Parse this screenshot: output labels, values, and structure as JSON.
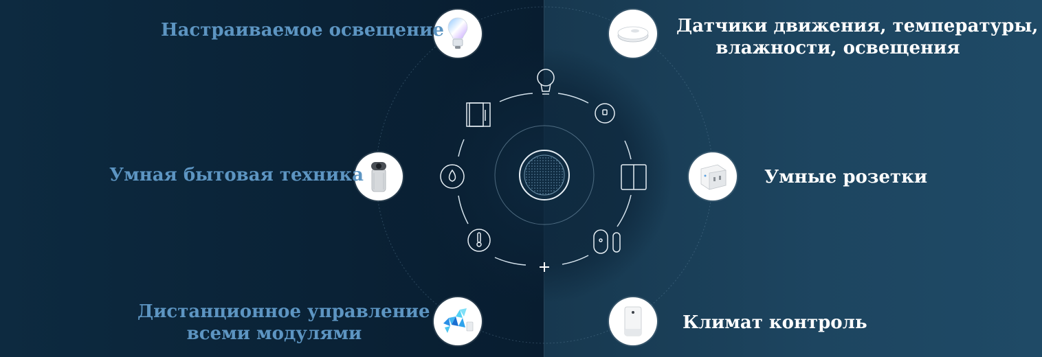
{
  "features": {
    "lighting": "Настраиваемое освещение",
    "sensors_line1": "Датчики движения, температуры,",
    "sensors_line2": "влажности, освещения",
    "appliances": "Умная бытовая техника",
    "sockets": "Умные розетки",
    "remote_line1": "Дистанционное управление",
    "remote_line2": "всеми модулями",
    "climate": "Климат контроль"
  },
  "hub_glyph": "+",
  "colors": {
    "left_bg": "#0a2236",
    "right_bg": "#1d4560",
    "label_blue": "#5d95c2",
    "label_white": "#ffffff",
    "ring_line": "#c8dbe8"
  },
  "icons": {
    "ring": [
      "lightbulb-icon",
      "camera-icon",
      "switch-icon",
      "door-sensor-icon",
      "thermometer-icon",
      "water-drop-icon",
      "wardrobe-icon"
    ],
    "discs": [
      "smart-bulb-icon",
      "robot-vacuum-icon",
      "smart-camera-icon",
      "smart-socket-icon",
      "led-panels-icon",
      "air-purifier-icon"
    ]
  }
}
